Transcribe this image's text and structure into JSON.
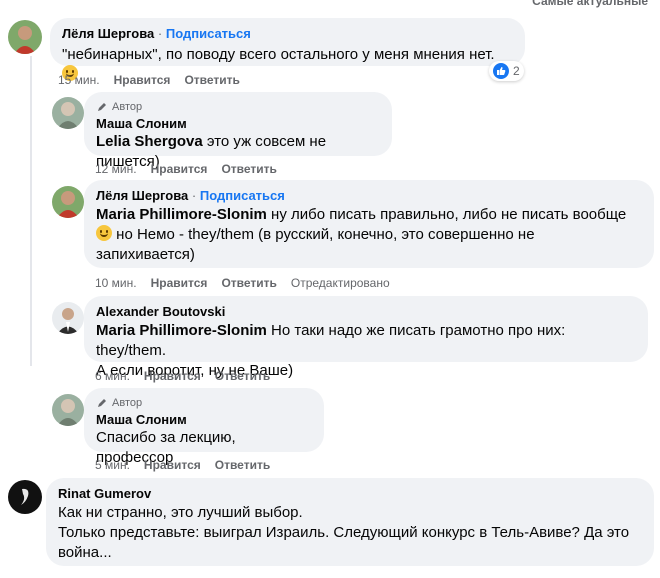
{
  "top_cut_label": "Самые актуальные",
  "comments": [
    {
      "author": "Лёля Шергова",
      "subscribe": "Подписаться",
      "text": "\"небинарных\", по поводу всего остального у меня мнения нет.",
      "time": "15 мин.",
      "like": "Нравится",
      "reply": "Ответить",
      "reaction_count": "2"
    },
    {
      "badge": "Автор",
      "author": "Маша Слоним",
      "mention": "Lelia Shergova",
      "text": " это уж совсем не пишется)",
      "time": "12 мин.",
      "like": "Нравится",
      "reply": "Ответить"
    },
    {
      "author": "Лёля Шергова",
      "subscribe": "Подписаться",
      "mention": "Maria Phillimore-Slonim",
      "text_line1": " ну либо писать правильно, либо не писать вообще",
      "text_line2": " но Немо - they/them (в русский, конечно, это совершенно не",
      "text_line3": "запихивается)",
      "time": "10 мин.",
      "like": "Нравится",
      "reply": "Ответить",
      "edited": "Отредактировано"
    },
    {
      "author": "Alexander Boutovski",
      "mention": "Maria Phillimore-Slonim",
      "text_line1": " Но таки надо же писать грамотно про них: they/them.",
      "text_line2": "А если воротит, ну не Ваше)",
      "time": "6 мин.",
      "like": "Нравится",
      "reply": "Ответить"
    },
    {
      "badge": "Автор",
      "author": "Маша Слоним",
      "text": "Спасибо за лекцию, профессор",
      "time": "5 мин.",
      "like": "Нравится",
      "reply": "Ответить"
    },
    {
      "author": "Rinat Gumerov",
      "text_line1": "Как ни странно, это лучший выбор.",
      "text_line2": "Только представьте: выиграл Израиль. Следующий конкурс в Тель-Авиве? Да это",
      "text_line3": "война..."
    }
  ],
  "colors": {
    "bubble": "#f0f2f5",
    "link": "#1877f2",
    "meta": "#65676b"
  }
}
